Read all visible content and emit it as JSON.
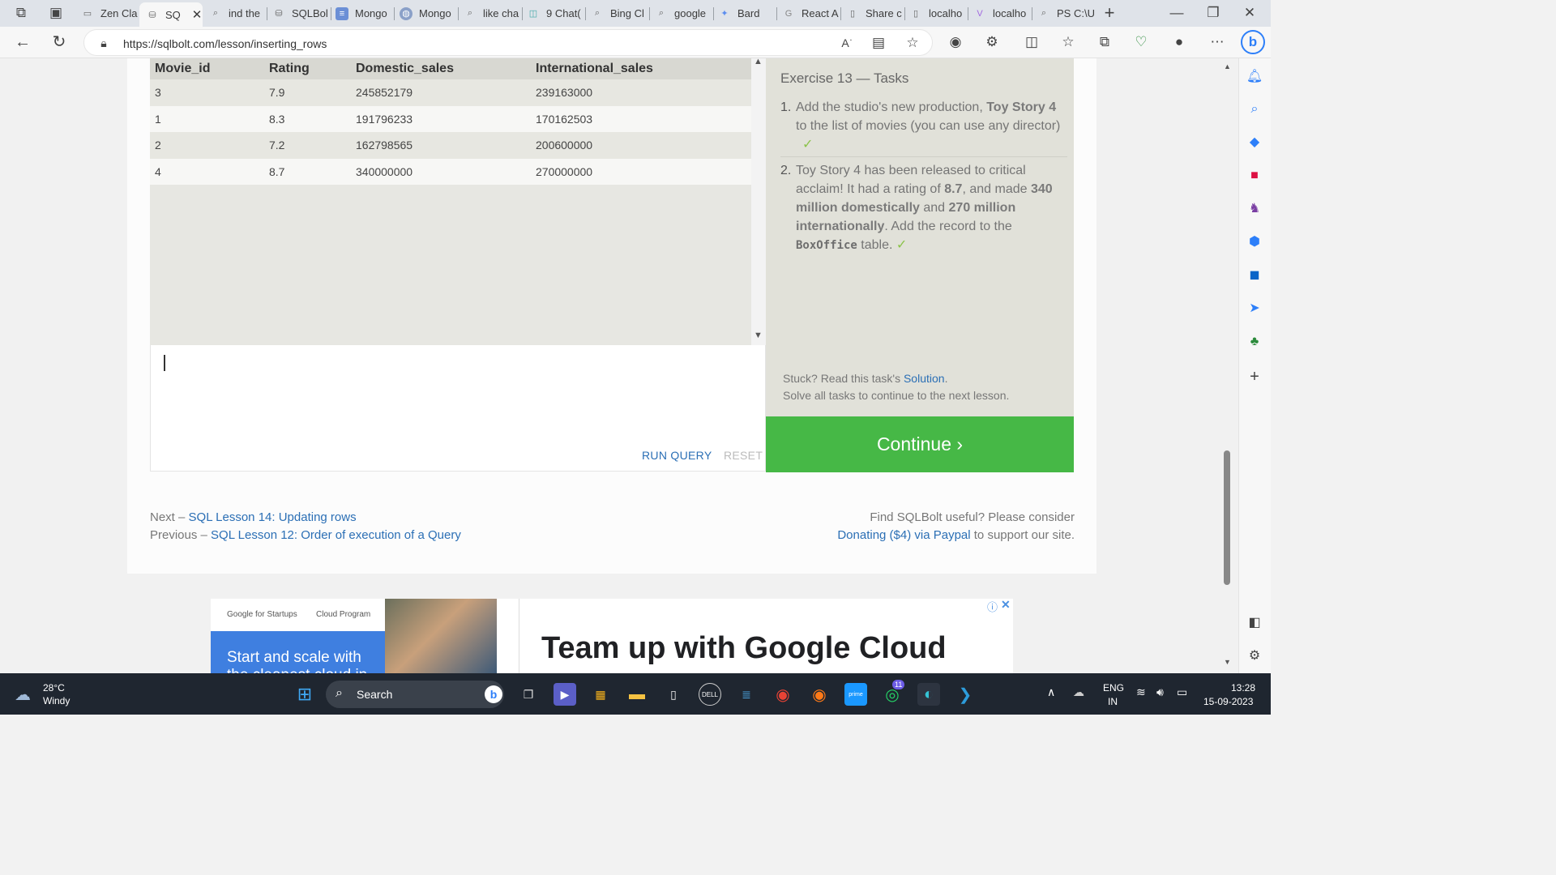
{
  "browser": {
    "tabs": [
      {
        "label": "Zen Cla"
      },
      {
        "label": "SQ"
      },
      {
        "label": "ind the"
      },
      {
        "label": "SQLBol"
      },
      {
        "label": "Mongo"
      },
      {
        "label": "Mongo"
      },
      {
        "label": "like cha"
      },
      {
        "label": "9 Chat("
      },
      {
        "label": "Bing Cl"
      },
      {
        "label": "google"
      },
      {
        "label": "Bard"
      },
      {
        "label": "React A"
      },
      {
        "label": "Share c"
      },
      {
        "label": "localho"
      },
      {
        "label": "localho"
      },
      {
        "label": "PS C:\\U"
      }
    ],
    "url": "https://sqlbolt.com/lesson/inserting_rows"
  },
  "results": {
    "columns": [
      "Movie_id",
      "Rating",
      "Domestic_sales",
      "International_sales"
    ],
    "rows": [
      [
        "3",
        "7.9",
        "245852179",
        "239163000"
      ],
      [
        "1",
        "8.3",
        "191796233",
        "170162503"
      ],
      [
        "2",
        "7.2",
        "162798565",
        "200600000"
      ],
      [
        "4",
        "8.7",
        "340000000",
        "270000000"
      ]
    ]
  },
  "editor": {
    "run_label": "RUN QUERY",
    "reset_label": "RESET"
  },
  "exercise": {
    "title": "Exercise 13 — Tasks",
    "task1": {
      "num": "1.",
      "a": "Add the studio's new production, ",
      "b": "Toy Story 4",
      "c": " to the list of movies (you can use any director)",
      "check": "✓"
    },
    "task2": {
      "num": "2.",
      "a": "Toy Story 4 has been released to critical acclaim! It had a rating of ",
      "b": "8.7",
      "c": ", and made ",
      "d": "340 million domestically",
      "e": " and ",
      "f": "270 million internationally",
      "g": ". Add the record to the ",
      "h": "BoxOffice",
      "i": " table.",
      "check": "✓"
    },
    "stuck_prefix": "Stuck? Read this task's ",
    "solution_link": "Solution",
    "stuck_suffix": ".",
    "solve_all": "Solve all tasks to continue to the next lesson.",
    "continue_label": "Continue ›"
  },
  "footer": {
    "next_prefix": "Next – ",
    "next_link": "SQL Lesson 14: Updating rows",
    "prev_prefix": "Previous – ",
    "prev_link": "SQL Lesson 12: Order of execution of a Query",
    "useful": "Find SQLBolt useful? Please consider",
    "donate_link": "Donating ($4) via Paypal",
    "donate_suffix": " to support our site."
  },
  "ad": {
    "brand1": "Google for Startups",
    "brand2": "Cloud Program",
    "tagline": "Start and scale with the cleanest cloud in",
    "headline": "Team up with Google Cloud"
  },
  "taskbar": {
    "temp": "28°C",
    "weather": "Windy",
    "search": "Search",
    "whatsapp_badge": "11",
    "lang1": "ENG",
    "lang2": "IN",
    "time": "13:28",
    "date": "15-09-2023"
  }
}
